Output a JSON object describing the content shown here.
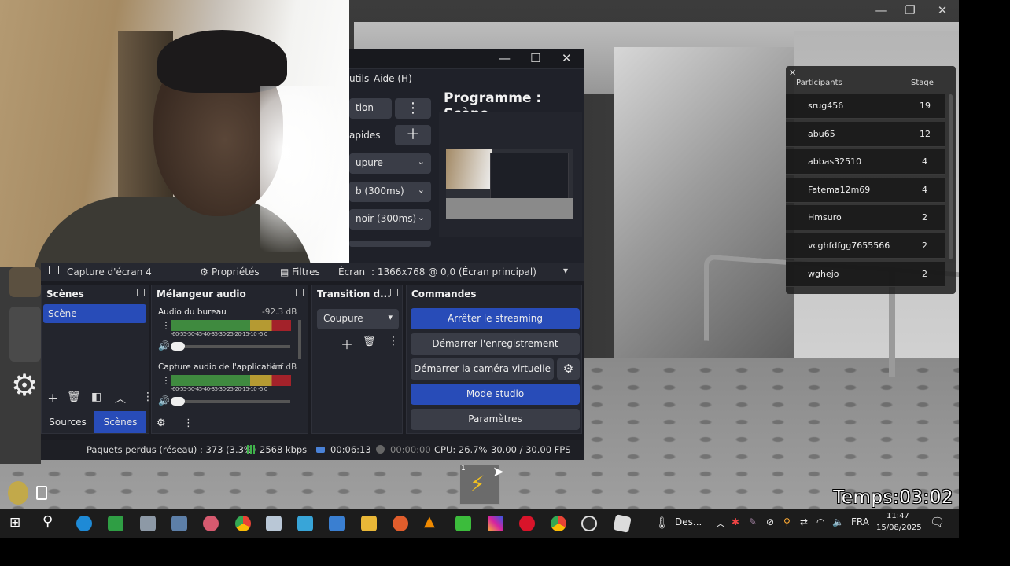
{
  "game": {
    "timer_label": "Temps:03:02",
    "window_controls": {
      "minimize": "—",
      "restore": "❐",
      "close": "✕"
    }
  },
  "leaderboard": {
    "close_label": "✕",
    "col_participants": "Participants",
    "col_stage": "Stage",
    "rows": [
      {
        "name": "srug456",
        "stage": "19"
      },
      {
        "name": "abu65",
        "stage": "12"
      },
      {
        "name": "abbas32510",
        "stage": "4"
      },
      {
        "name": "Fatema12m69",
        "stage": "4"
      },
      {
        "name": "Hmsuro",
        "stage": "2"
      },
      {
        "name": "vcghfdfgg7655566",
        "stage": "2"
      },
      {
        "name": "wghejo",
        "stage": "2"
      }
    ]
  },
  "obs_top": {
    "menu_outils": "utils",
    "menu_aide": "Aide (H)",
    "window_controls": {
      "minimize": "—",
      "maximize": "☐",
      "close": "✕"
    },
    "btn_transition": "tion",
    "btn_rapides": "apides",
    "select_coupure": "upure",
    "select_fade": "b (300ms)",
    "select_noir": "noir (300ms)",
    "programme_title": "Programme : Scène"
  },
  "source_bar": {
    "source_name": "Capture d'écran 4",
    "properties": "Propriétés",
    "filters": "Filtres",
    "screen_label": "Écran",
    "screen_value": ": 1366x768 @ 0,0 (Écran principal)"
  },
  "scenes": {
    "title": "Scènes",
    "items": [
      "Scène"
    ],
    "tab_sources": "Sources",
    "tab_scenes": "Scènes"
  },
  "mixer": {
    "title": "Mélangeur audio",
    "tracks": [
      {
        "name": "Audio du bureau",
        "level": "-92.3 dB",
        "fraction": 0.05
      },
      {
        "name": "Capture audio de l'application",
        "level": "-inf dB",
        "fraction": 0.05
      }
    ],
    "ticks": "-60-55-50-45-40-35-30-25-20-15-10 -5 0"
  },
  "transitions": {
    "title": "Transition d...",
    "selected": "Coupure"
  },
  "commands": {
    "title": "Commandes",
    "stop_streaming": "Arrêter le streaming",
    "start_recording": "Démarrer l'enregistrement",
    "start_virtual_cam": "Démarrer la caméra virtuelle",
    "studio_mode": "Mode studio",
    "settings": "Paramètres"
  },
  "status": {
    "dropped": "Paquets perdus (réseau) : 373 (3.3%)",
    "bitrate": "2568 kbps",
    "stream_time": "00:06:13",
    "rec_time": "00:00:00",
    "cpu": "CPU: 26.7%",
    "fps": "30.00 / 30.00 FPS"
  },
  "taskbar": {
    "pinned_label": "Des...",
    "language": "FRA",
    "time": "11:47",
    "date": "15/08/2025",
    "badge": "1"
  },
  "colors": {
    "obs_blue": "#284cb8",
    "obs_panel": "#23252d",
    "meter_green": "#3f8a3f",
    "meter_yellow": "#b59a32",
    "meter_red": "#a3222a"
  }
}
